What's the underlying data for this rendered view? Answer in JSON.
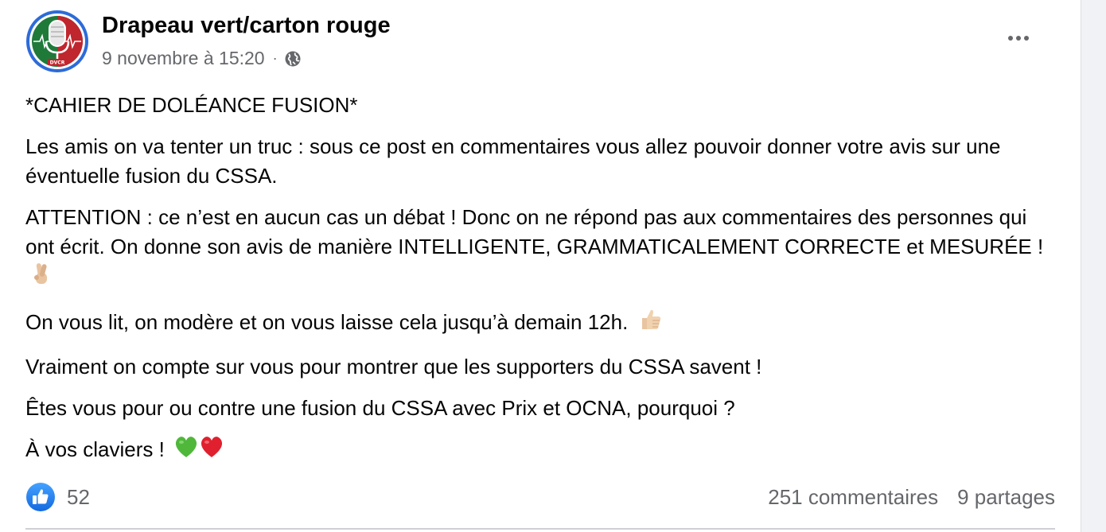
{
  "post": {
    "author": "Drapeau vert/carton rouge",
    "avatar_text": "DVCR",
    "timestamp": "9 novembre à 15:20",
    "separator": "·",
    "privacy_icon": "globe-icon",
    "options_icon": "more-horizontal-icon",
    "paragraphs": {
      "p1": "*CAHIER DE DOLÉANCE FUSION*",
      "p2": "Les amis on va tenter un truc : sous ce post en commentaires vous allez pouvoir donner votre avis sur une éventuelle fusion du CSSA.",
      "p3": "ATTENTION : ce n’est en aucun cas un débat ! Donc on ne répond pas aux commentaires des personnes qui ont écrit. On donne son avis de manière INTELLIGENTE, GRAMMATICALEMENT CORRECTE et MESURÉE !",
      "p4": "On vous lit, on modère et on vous laisse cela jusqu’à demain 12h.",
      "p5": "Vraiment on compte sur vous pour montrer que les supporters du CSSA savent !",
      "p6": "Êtes vous pour ou contre une fusion du CSSA avec Prix et OCNA, pourquoi ?",
      "p7": "À vos claviers !"
    },
    "emojis": {
      "crossed_fingers": "crossed-fingers-emoji",
      "thumbs_up": "thumbs-up-emoji",
      "green_heart": "green-heart-emoji",
      "red_heart": "red-heart-emoji"
    },
    "reactions": {
      "icon": "like-icon",
      "count": "52"
    },
    "comments": "251 commentaires",
    "shares": "9 partages"
  },
  "colors": {
    "brand_blue": "#1877f2",
    "text_primary": "#050505",
    "text_secondary": "#65676b",
    "avatar_green": "#1f7a3a",
    "avatar_red": "#c0262d",
    "avatar_ring": "#2d6bd8"
  }
}
